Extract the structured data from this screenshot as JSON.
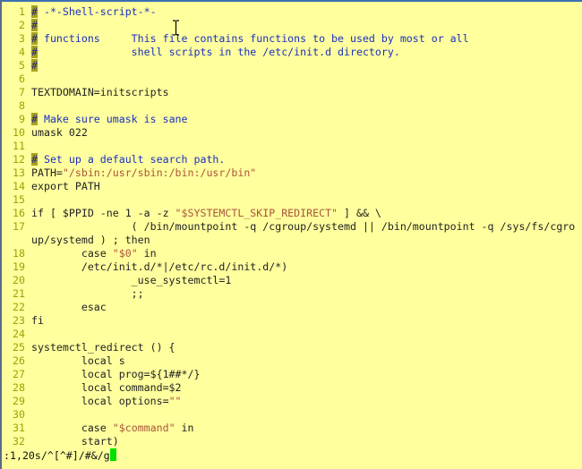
{
  "editor": {
    "lines": [
      {
        "n": "1",
        "seg": [
          [
            "h",
            "#"
          ],
          [
            "c",
            " -*-Shell-script-*-"
          ]
        ]
      },
      {
        "n": "2",
        "seg": [
          [
            "h",
            "#"
          ]
        ]
      },
      {
        "n": "3",
        "seg": [
          [
            "h",
            "#"
          ],
          [
            "c",
            " functions     This file contains functions to be used by most or all"
          ]
        ]
      },
      {
        "n": "4",
        "seg": [
          [
            "h",
            "#"
          ],
          [
            "c",
            "               shell scripts in the /etc/init.d directory."
          ]
        ]
      },
      {
        "n": "5",
        "seg": [
          [
            "h",
            "#"
          ]
        ]
      },
      {
        "n": "6",
        "seg": []
      },
      {
        "n": "7",
        "seg": [
          [
            "n",
            "TEXTDOMAIN=initscripts"
          ]
        ]
      },
      {
        "n": "8",
        "seg": []
      },
      {
        "n": "9",
        "seg": [
          [
            "h",
            "#"
          ],
          [
            "c",
            " Make sure umask is sane"
          ]
        ]
      },
      {
        "n": "10",
        "seg": [
          [
            "n",
            "umask 022"
          ]
        ]
      },
      {
        "n": "11",
        "seg": []
      },
      {
        "n": "12",
        "seg": [
          [
            "h",
            "#"
          ],
          [
            "c",
            " Set up a default search path."
          ]
        ]
      },
      {
        "n": "13",
        "seg": [
          [
            "n",
            "PATH="
          ],
          [
            "s",
            "\"/sbin:/usr/sbin:/bin:/usr/bin\""
          ]
        ]
      },
      {
        "n": "14",
        "seg": [
          [
            "n",
            "export PATH"
          ]
        ]
      },
      {
        "n": "15",
        "seg": []
      },
      {
        "n": "16",
        "seg": [
          [
            "n",
            "if [ $PPID -ne 1 -a -z "
          ],
          [
            "s",
            "\"$SYSTEMCTL_SKIP_REDIRECT\""
          ],
          [
            "n",
            " ] && \\"
          ]
        ]
      },
      {
        "n": "17",
        "seg": [
          [
            "n",
            "                ( /bin/mountpoint -q /cgroup/systemd || /bin/mountpoint -q /sys/fs/cgro"
          ]
        ]
      },
      {
        "n": "",
        "seg": [
          [
            "n",
            "up/systemd ) ; then"
          ]
        ]
      },
      {
        "n": "18",
        "seg": [
          [
            "n",
            "        case "
          ],
          [
            "s",
            "\"$0\""
          ],
          [
            "n",
            " in"
          ]
        ]
      },
      {
        "n": "19",
        "seg": [
          [
            "n",
            "        /etc/init.d/*|/etc/rc.d/init.d/*)"
          ]
        ]
      },
      {
        "n": "20",
        "seg": [
          [
            "n",
            "                _use_systemctl=1"
          ]
        ]
      },
      {
        "n": "21",
        "seg": [
          [
            "n",
            "                ;;"
          ]
        ]
      },
      {
        "n": "22",
        "seg": [
          [
            "n",
            "        esac"
          ]
        ]
      },
      {
        "n": "23",
        "seg": [
          [
            "n",
            "fi"
          ]
        ]
      },
      {
        "n": "24",
        "seg": []
      },
      {
        "n": "25",
        "seg": [
          [
            "n",
            "systemctl_redirect () {"
          ]
        ]
      },
      {
        "n": "26",
        "seg": [
          [
            "n",
            "        local s"
          ]
        ]
      },
      {
        "n": "27",
        "seg": [
          [
            "n",
            "        local prog=${1##*/}"
          ]
        ]
      },
      {
        "n": "28",
        "seg": [
          [
            "n",
            "        local command=$2"
          ]
        ]
      },
      {
        "n": "29",
        "seg": [
          [
            "n",
            "        local options="
          ],
          [
            "s",
            "\"\""
          ]
        ]
      },
      {
        "n": "30",
        "seg": []
      },
      {
        "n": "31",
        "seg": [
          [
            "n",
            "        case "
          ],
          [
            "s",
            "\"$command\""
          ],
          [
            "n",
            " in"
          ]
        ]
      },
      {
        "n": "32",
        "seg": [
          [
            "n",
            "        start)"
          ]
        ]
      }
    ]
  },
  "cmdline": {
    "text": ":1,20s/^[^#]/#&/g"
  },
  "colors": {
    "background": "#ffff9e",
    "line_number": "#a0a000",
    "comment": "#1a2fc0",
    "string": "#a8553a",
    "search_highlight": "#a8a21e",
    "cursor": "#00e000"
  },
  "icons": {
    "pointer": "text-cursor-ibeam-icon"
  }
}
